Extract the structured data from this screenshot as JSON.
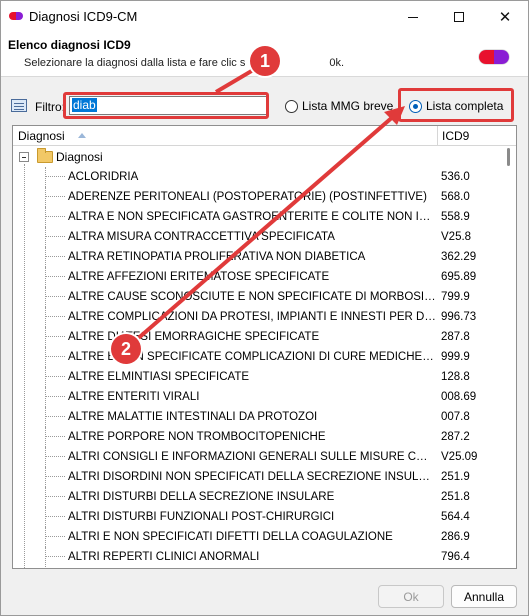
{
  "window": {
    "title": "Diagnosi ICD9-CM",
    "controls": {
      "minimize": "minimize",
      "maximize": "maximize",
      "close": "✕"
    }
  },
  "header": {
    "title": "Elenco diagnosi ICD9",
    "subtitle": "Selezionare la diagnosi dalla lista e fare clic s",
    "subtitle_tail": "0k."
  },
  "filter": {
    "label": "Filtro:",
    "value": "diab",
    "options": [
      {
        "label": "Lista MMG breve",
        "selected": false
      },
      {
        "label": "Lista completa",
        "selected": true
      }
    ]
  },
  "list": {
    "columns": [
      "Diagnosi",
      "ICD9"
    ],
    "root_label": "Diagnosi",
    "rows": [
      {
        "desc": "ACLORIDRIA",
        "code": "536.0"
      },
      {
        "desc": "ADERENZE PERITONEALI (POSTOPERATORIE) (POSTINFETTIVE)",
        "code": "568.0"
      },
      {
        "desc": "ALTRA E NON SPECIFICATA GASTROENTERITE E COLITE NON INFETTIVA",
        "code": "558.9"
      },
      {
        "desc": "ALTRA MISURA CONTRACCETTIVA SPECIFICATA",
        "code": "V25.8"
      },
      {
        "desc": "ALTRA RETINOPATIA PROLIFERATIVA NON DIABETICA",
        "code": "362.29"
      },
      {
        "desc": "ALTRE AFFEZIONI ERITEMATOSE SPECIFICATE",
        "code": "695.89"
      },
      {
        "desc": "ALTRE CAUSE SCONOSCIUTE E NON SPECIFICATE DI MORBOSITA' O MORTALITA'",
        "code": "799.9"
      },
      {
        "desc": "ALTRE COMPLICAZIONI DA PROTESI, IMPIANTI E INNESTI PER DIALISI RENALE",
        "code": "996.73"
      },
      {
        "desc": "ALTRE DIATESI EMORRAGICHE SPECIFICATE",
        "code": "287.8"
      },
      {
        "desc": "ALTRE E NON SPECIFICATE COMPLICAZIONI DI CURE MEDICHE, NON CLASSIFICATE",
        "code": "999.9"
      },
      {
        "desc": "ALTRE ELMINTIASI SPECIFICATE",
        "code": "128.8"
      },
      {
        "desc": "ALTRE ENTERITI VIRALI",
        "code": "008.69"
      },
      {
        "desc": "ALTRE MALATTIE INTESTINALI DA PROTOZOI",
        "code": "007.8"
      },
      {
        "desc": "ALTRE PORPORE NON TROMBOCITOPENICHE",
        "code": "287.2"
      },
      {
        "desc": "ALTRI CONSIGLI E INFORMAZIONI GENERALI SULLE MISURE CONTRACCETTIVE",
        "code": "V25.09"
      },
      {
        "desc": "ALTRI DISORDINI NON SPECIFICATI DELLA SECREZIONE INSULARE",
        "code": "251.9"
      },
      {
        "desc": "ALTRI DISTURBI DELLA SECREZIONE INSULARE",
        "code": "251.8"
      },
      {
        "desc": "ALTRI DISTURBI FUNZIONALI POST-CHIRURGICI",
        "code": "564.4"
      },
      {
        "desc": "ALTRI E NON SPECIFICATI DIFETTI DELLA COAGULAZIONE",
        "code": "286.9"
      },
      {
        "desc": "ALTRI REPERTI CLINICI ANORMALI",
        "code": "796.4"
      }
    ]
  },
  "buttons": {
    "ok": "Ok",
    "cancel": "Annulla"
  },
  "annotations": {
    "step1": "1",
    "step2": "2",
    "color": "#e03a3a"
  }
}
